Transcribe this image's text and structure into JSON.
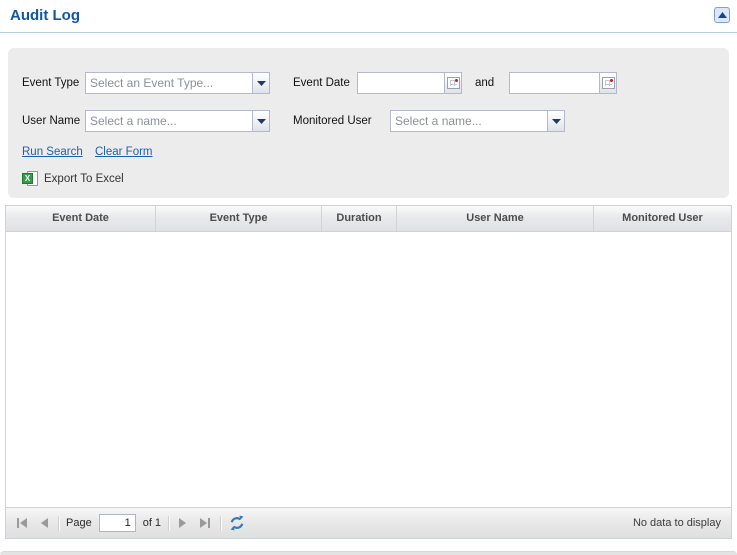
{
  "panel": {
    "title": "Audit Log"
  },
  "form": {
    "event_type_label": "Event Type",
    "event_type_placeholder": "Select an Event Type...",
    "event_date_label": "Event Date",
    "event_date_from": "",
    "and_label": "and",
    "event_date_to": "",
    "user_name_label": "User Name",
    "user_name_placeholder": "Select a name...",
    "monitored_user_label": "Monitored User",
    "monitored_user_placeholder": "Select a name...",
    "run_search_label": "Run Search",
    "clear_form_label": "Clear Form",
    "export_label": "Export To Excel",
    "excel_icon_letter": "X"
  },
  "grid": {
    "columns": [
      "Event Date",
      "Event Type",
      "Duration",
      "User Name",
      "Monitored User"
    ],
    "rows": []
  },
  "pager": {
    "page_label": "Page",
    "page_value": "1",
    "of_label": "of 1",
    "empty_text": "No data to display"
  },
  "colors": {
    "title_blue": "#1057a3",
    "link_blue": "#1b62ad",
    "trigger_arrow_navy": "#1c3a6e",
    "refresh_blue": "#2e7cc0",
    "excel_green": "#2f9e44",
    "form_panel_gray": "#ececec"
  }
}
